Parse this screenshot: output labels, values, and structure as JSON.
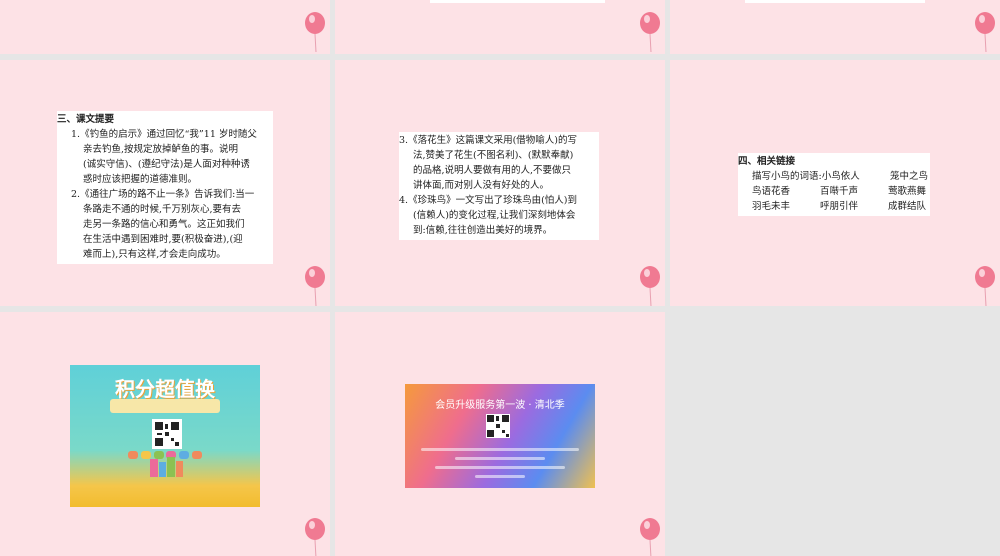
{
  "slides": {
    "s4": {
      "heading": "三、课文提要",
      "lines": [
        "1.《钓鱼的启示》通过回忆“我”11 岁时随父",
        "亲去钓鱼,按规定放掉鲈鱼的事。说明",
        "(诚实守信)、(遵纪守法)是人面对种种诱",
        "惑时应该把握的道德准则。",
        "2.《通往广场的路不止一条》告诉我们:当一",
        "条路走不通的时候,千万别灰心,要有去",
        "走另一条路的信心和勇气。这正如我们",
        "在生活中遇到困难时,要(积极奋进),(迎",
        "难而上),只有这样,才会走向成功。"
      ]
    },
    "s5": {
      "lines": [
        "3.《落花生》这篇课文采用(借物喻人)的写",
        "法,赞美了花生(不图名利)、(默默奉献)",
        "的品格,说明人要做有用的人,不要做只",
        "讲体面,而对别人没有好处的人。",
        "4.《珍珠鸟》一文写出了珍珠鸟由(怕人)到",
        "(信赖人)的变化过程,让我们深刻地体会",
        "到:信赖,往往创造出美好的境界。"
      ]
    },
    "s6": {
      "heading": "四、相关链接",
      "intro": "描写小鸟的词语:小鸟依人",
      "intro_b": "笼中之鸟",
      "row2": [
        "鸟语花香",
        "百啭千声",
        "莺歌燕舞"
      ],
      "row3": [
        "羽毛未丰",
        "呼朋引伴",
        "成群结队"
      ]
    },
    "s7": {
      "ad_title": "积分超值换"
    },
    "s8": {
      "ad_title": "会员升级服务第一波 · 清北季"
    }
  },
  "colors": {
    "slide_bg": "#fde2e6",
    "gap_bg": "#e6e6e6",
    "balloon": "#f06a86"
  },
  "icons": [
    "balloon-icon",
    "qr-code-icon"
  ]
}
